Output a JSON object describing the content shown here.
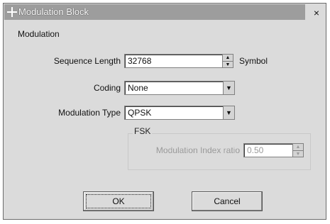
{
  "window": {
    "title": "Modulation Block",
    "close_glyph": "×"
  },
  "group": {
    "title": "Modulation"
  },
  "sequence_length": {
    "label": "Sequence Length",
    "value": "32768",
    "unit": "Symbol"
  },
  "coding": {
    "label": "Coding",
    "value": "None"
  },
  "modulation_type": {
    "label": "Modulation Type",
    "value": "QPSK"
  },
  "fsk": {
    "title": "FSK",
    "index_label": "Modulation Index ratio",
    "index_value": "0.50"
  },
  "buttons": {
    "ok": "OK",
    "cancel": "Cancel"
  },
  "icons": {
    "title_icon": "app-icon",
    "spin_up": "▲",
    "spin_down": "▼",
    "dropdown": "▼"
  }
}
